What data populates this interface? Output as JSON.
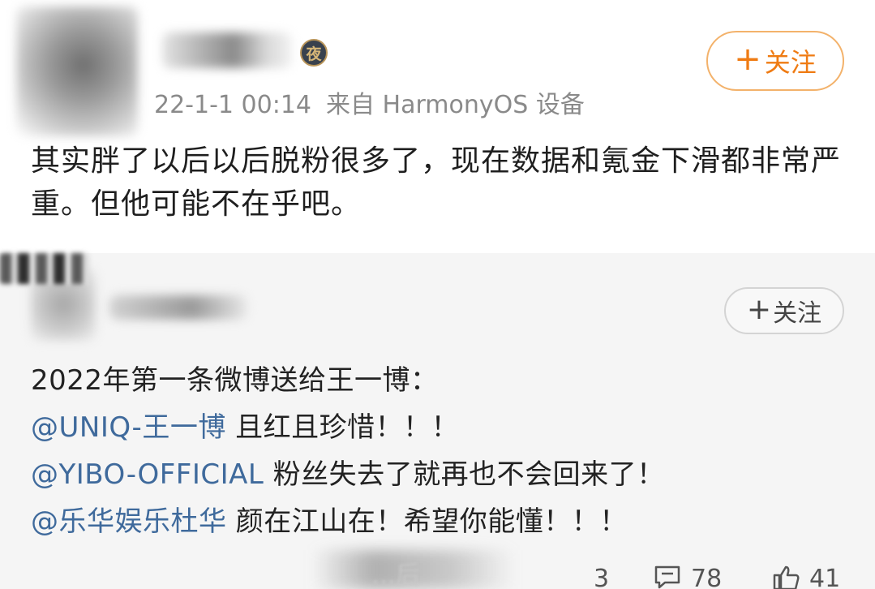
{
  "post1": {
    "badge_char": "夜",
    "follow_label": "关注",
    "timestamp": "22-1-1 00:14",
    "source": "来自 HarmonyOS 设备",
    "text": "其实胖了以后以后脱粉很多了，现在数据和氪金下滑都非常严重。但他可能不在乎吧。",
    "accent_color": "#ef7b13"
  },
  "post2": {
    "follow_label": "关注",
    "lines": [
      {
        "mention": "",
        "text": "2022年第一条微博送给王一博："
      },
      {
        "mention": "@UNIQ-王一博",
        "text": " 且红且珍惜！！！"
      },
      {
        "mention": "@YIBO-OFFICIAL",
        "text": " 粉丝失去了就再也不会回来了！"
      },
      {
        "mention": "@乐华娱乐杜华",
        "text": " 颜在江山在！希望你能懂！！！"
      }
    ],
    "obscured_text": "…后",
    "repost_count": "3",
    "comment_count": "78",
    "like_count": "41",
    "mention_color": "#3f6a9c"
  },
  "icons": {
    "follow": "plus-icon",
    "comment": "comment-icon",
    "like": "thumbs-up-icon"
  }
}
